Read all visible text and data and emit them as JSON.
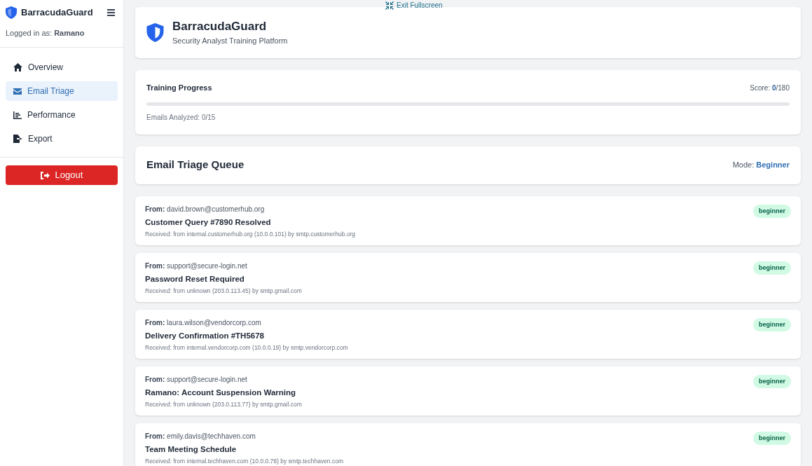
{
  "sidebar": {
    "title": "BarracudaGuard",
    "logged_in": "Logged in as: **Ramano**",
    "items": [
      {
        "label": "Overview",
        "selected": false
      },
      {
        "label": "Email Triage",
        "selected": true
      },
      {
        "label": "Performance",
        "selected": false
      },
      {
        "label": "Export",
        "selected": false
      }
    ],
    "logout": "Logout"
  },
  "exit_fullscreen": "Exit Fullscreen",
  "header": {
    "title": "BarracudaGuard",
    "subtitle": "Security Analyst Training Platform"
  },
  "progress": {
    "title": "Training Progress",
    "score_label": "Score:",
    "score_value": "0",
    "score_total": "/180",
    "level": 0,
    "analyzed": "Emails Analyzed: 0/15"
  },
  "queue": {
    "title": "Email Triage Queue",
    "mode_label": "Mode:",
    "mode_value": "Beginner"
  },
  "emails": [
    {
      "from_label": "From:",
      "from": "david.brown@customerhub.org",
      "subject": "Customer Query #7890 Resolved",
      "received": "Received: from internal.customerhub.org (10.0.0.101) by smtp.customerhub.org",
      "badge": "beginner"
    },
    {
      "from_label": "From:",
      "from": "support@secure-login.net",
      "subject": "Password Reset Required",
      "received": "Received: from unknown (203.0.113.45) by smtp.gmail.com",
      "badge": "beginner"
    },
    {
      "from_label": "From:",
      "from": "laura.wilson@vendorcorp.com",
      "subject": "Delivery Confirmation #TH5678",
      "received": "Received: from internal.vendorcorp.com (10.0.0.19) by smtp.vendorcorp.com",
      "badge": "beginner"
    },
    {
      "from_label": "From:",
      "from": "support@secure-login.net",
      "subject": "Ramano: Account Suspension Warning",
      "received": "Received: from unknown (203.0.113.77) by smtp.gmail.com",
      "badge": "beginner"
    },
    {
      "from_label": "From:",
      "from": "emily.davis@techhaven.com",
      "subject": "Team Meeting Schedule",
      "received": "Received: from internal.techhaven.com (10.0.0.78) by smtp.techhaven.com",
      "badge": "beginner"
    }
  ]
}
